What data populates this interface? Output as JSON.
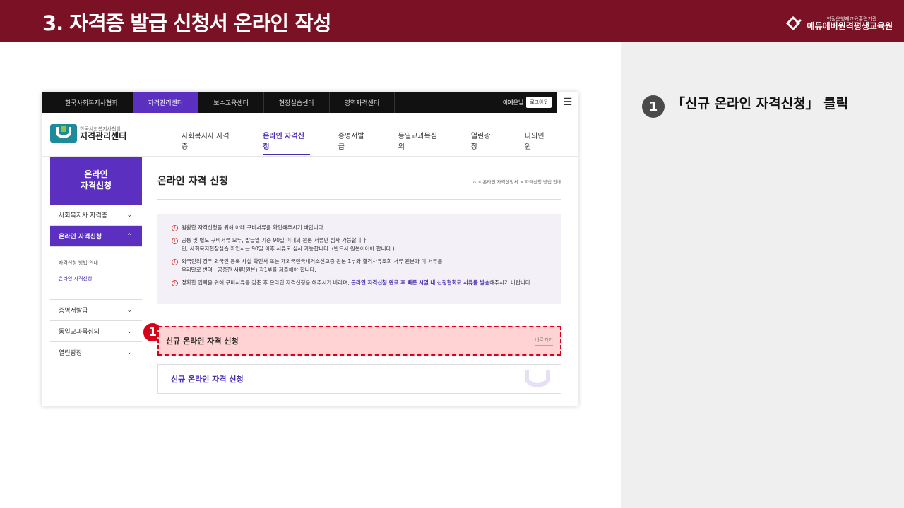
{
  "banner": {
    "title": "3. 자격증 발급 신청서 온라인 작성",
    "brand_sub": "학점은행제교육훈련기관",
    "brand_name": "에듀에버원격평생교육원"
  },
  "instruction": {
    "number": "1",
    "text": "「신규 온라인 자격신청」 클릭"
  },
  "site": {
    "topnav": {
      "tabs": [
        "한국사회복지사협회",
        "자격관리센터",
        "보수교육센터",
        "현장실습센터",
        "영역자격센터"
      ],
      "active_index": 1,
      "user_name": "이예은님",
      "logout": "로그아웃",
      "menu_icon": "☰"
    },
    "logo": {
      "small": "한국사회복지사협회",
      "big": "지격관리센터"
    },
    "mainmenu": [
      "사회복지사 자격증",
      "온라인 자격신청",
      "증명서발급",
      "동일교과목심의",
      "열린광장",
      "나의민원"
    ],
    "lnb": {
      "head_line1": "온라인",
      "head_line2": "자격신청",
      "items": [
        "사회복지사 자격증",
        "온라인 자격신청",
        "증명서발급",
        "동일교과목심의",
        "열린광장"
      ],
      "sub_items": [
        "자격신청 방법 안내",
        "온라인 자격신청"
      ]
    },
    "content": {
      "title": "온라인 자격 신청",
      "breadcrumb": "⌂ > 온라인 자격신청서 > 자격신청 방법 안내",
      "notices": [
        "원활한 자격신청을 위해 아래 구비서류를 확인해주시기 바랍니다.",
        "공통 및 별도 구비서류 모두, 발급일 기준 90일 이내의 원본 서류만 심사 가능합니다\n단, 사회복지현장실습 확인서는 90일 이후 서류도 심사 가능합니다. (반드시 원본이어야 합니다.)",
        "외국인의 경우 외국인 등록 사실 확인서 또는 재외국민국내거소신고증 원본 1부와 결격사유조회 서류 원본과 이 서류를\n우리말로 번역 · 공증한 서류(원본) 각1부를 제출해야 합니다.",
        "정확한 입력을 위해 구비서류를 갖춘 후 온라인 자격신청을 해주시기 바라며,"
      ],
      "notice_emphasis": "온라인 자격신청 완료 후 빠른 시일 내 신청협회로 서류를 발송",
      "notice_tail": "해주시기 바랍니다.",
      "highlight_label": "신규 온라인 자격 신청",
      "highlight_go": "바로가기",
      "marker": "1",
      "apply_label": "신규 온라인 자격 신청"
    }
  },
  "colors": {
    "banner": "#7a1125",
    "accent_purple": "#5b2fbf",
    "highlight_red": "#d9001b"
  }
}
